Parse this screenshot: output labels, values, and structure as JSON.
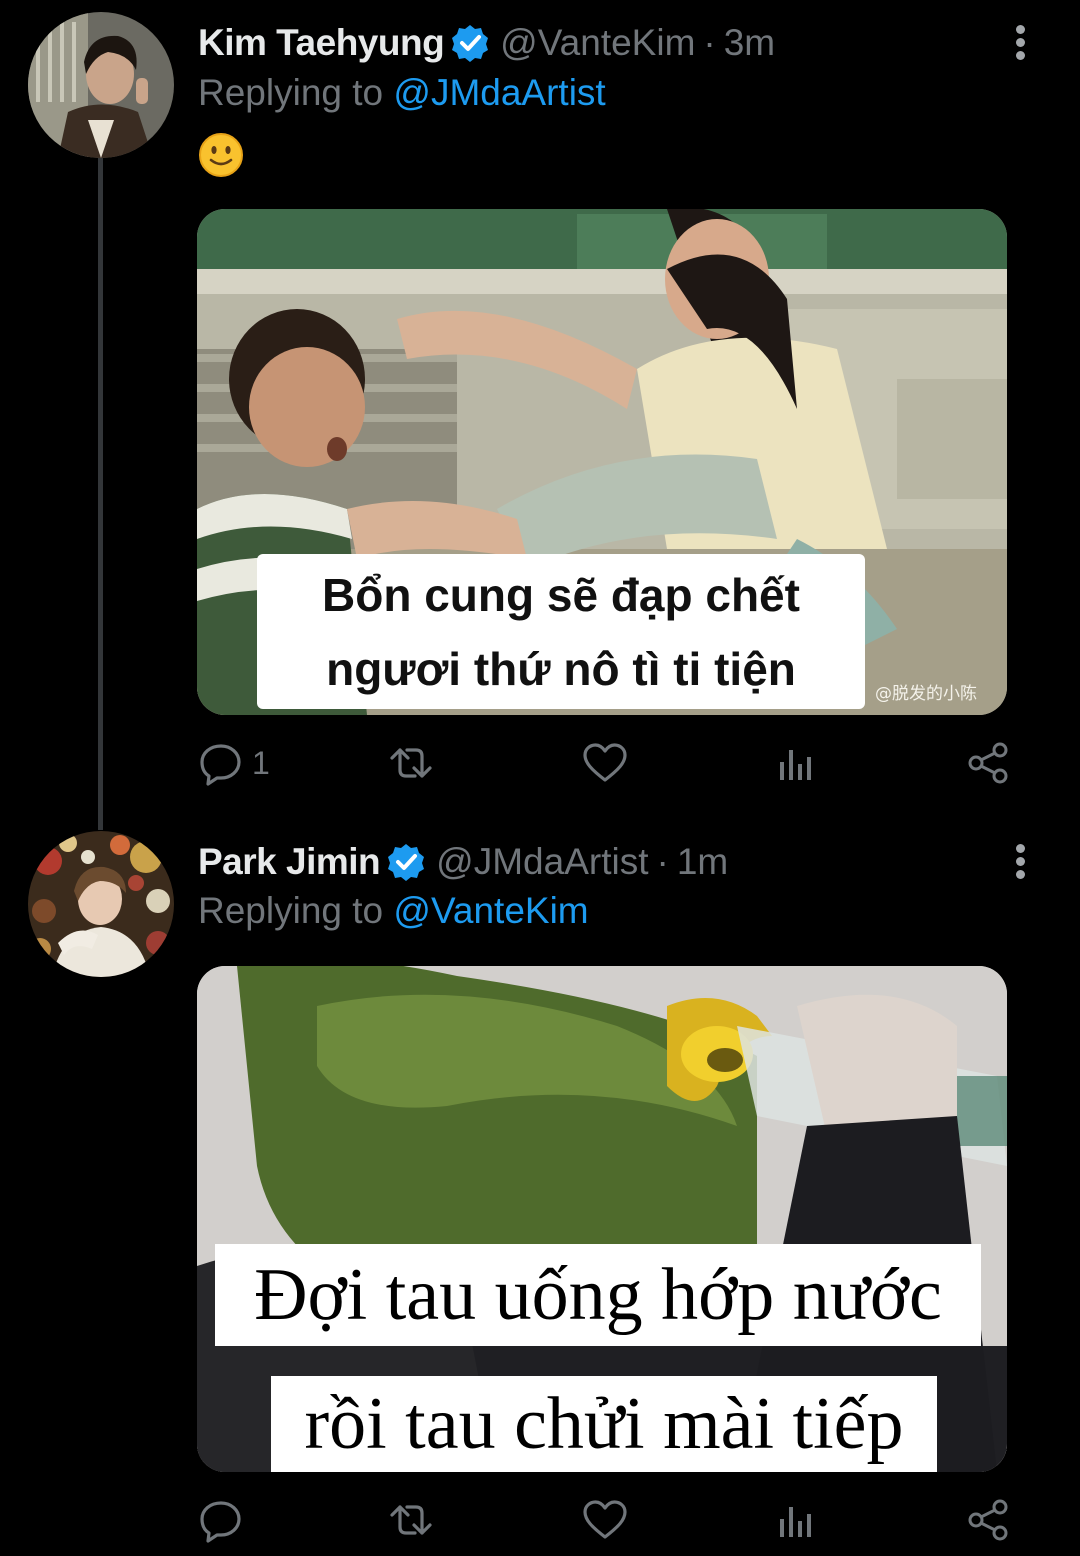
{
  "tweets": [
    {
      "name": "Kim Taehyung",
      "handle": "@VanteKim",
      "separator": "·",
      "time": "3m",
      "replying_prefix": "Replying to",
      "replying_to": "@JMdaArtist",
      "emoji": "🙂",
      "media": {
        "caption_line1": "Bổn cung sẽ đạp chết",
        "caption_line2": "ngươi thứ nô tì ti tiện",
        "watermark": "@脱发的小陈"
      },
      "stats": {
        "replies": "1"
      }
    },
    {
      "name": "Park Jimin",
      "handle": "@JMdaArtist",
      "separator": "·",
      "time": "1m",
      "replying_prefix": "Replying to",
      "replying_to": "@VanteKim",
      "media": {
        "caption_line1": "Đợi tau uống hớp nước",
        "caption_line2": "rồi tau chửi mài tiếp"
      },
      "stats": {
        "replies": ""
      }
    }
  ],
  "icons": {
    "verified": "verified-badge-icon",
    "more": "more-vertical-icon",
    "reply": "reply-icon",
    "retweet": "retweet-icon",
    "like": "heart-icon",
    "views": "analytics-icon",
    "share": "share-icon"
  },
  "colors": {
    "background": "#000000",
    "accent": "#1d9bf0",
    "muted": "#71767b",
    "text": "#e7e9ea"
  }
}
